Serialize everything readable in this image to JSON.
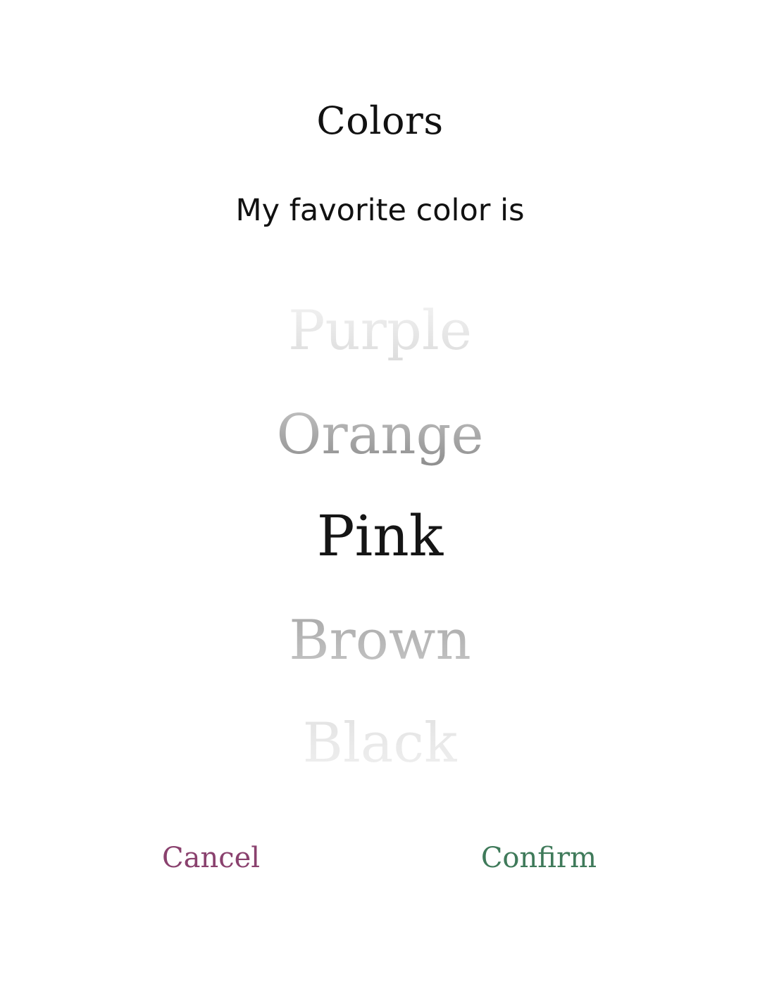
{
  "dialog": {
    "title": "Colors",
    "prompt": "My favorite color is"
  },
  "picker": {
    "items": [
      "Purple",
      "Orange",
      "Pink",
      "Brown",
      "Black"
    ],
    "selected": "Pink"
  },
  "actions": {
    "cancel_label": "Cancel",
    "confirm_label": "Confirm"
  },
  "colors": {
    "cancel": "#8a416e",
    "confirm": "#3f7a5a",
    "selected_text": "#151515"
  }
}
